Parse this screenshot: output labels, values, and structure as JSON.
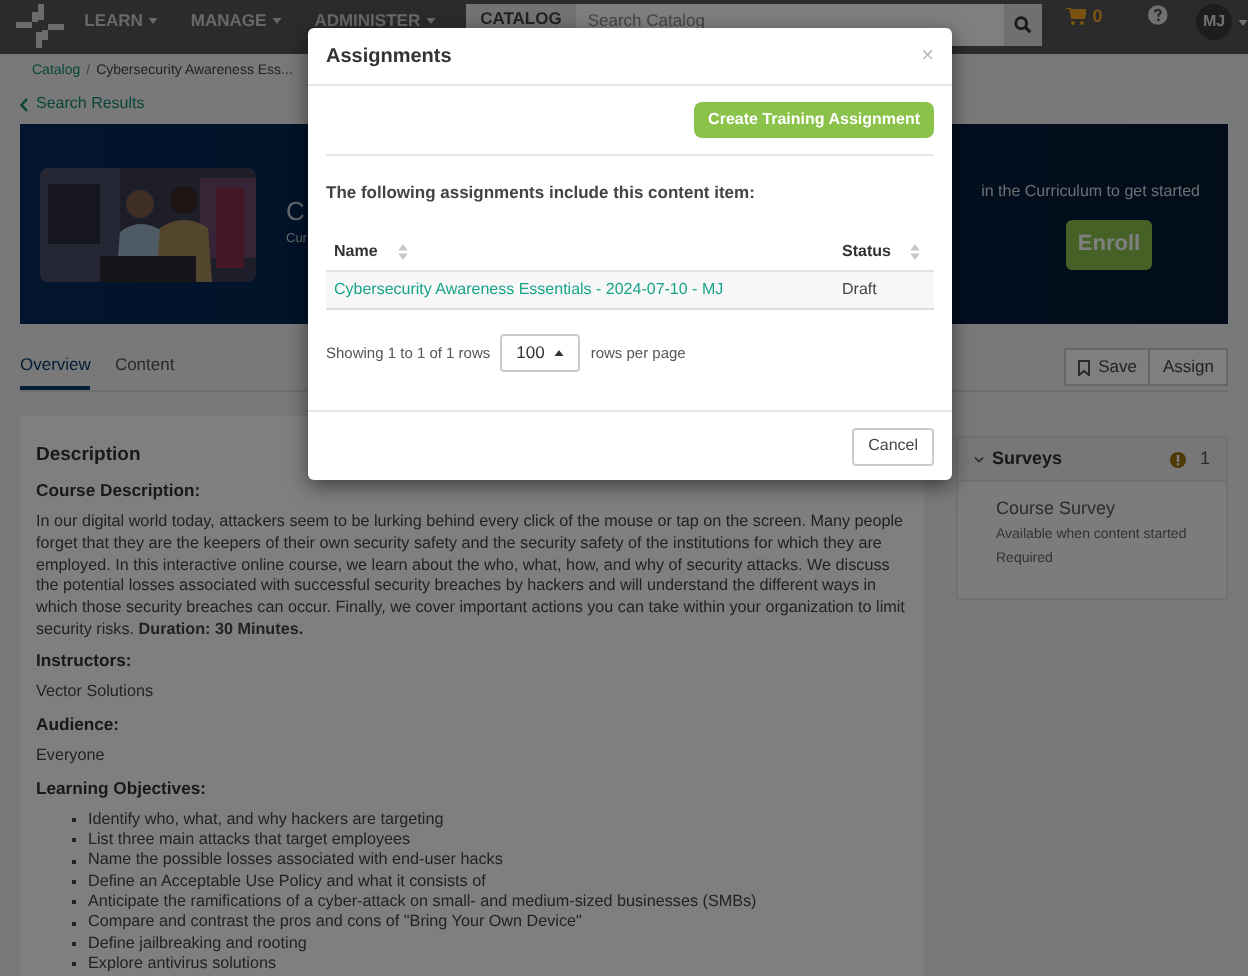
{
  "nav": {
    "items": [
      {
        "label": "LEARN"
      },
      {
        "label": "MANAGE"
      },
      {
        "label": "ADMINISTER"
      }
    ],
    "catalog_tab": "CATALOG",
    "search": {
      "placeholder": "Search Catalog"
    },
    "cart_count": "0",
    "user_initials": "MJ"
  },
  "breadcrumb": [
    "Catalog",
    "Cybersecurity Awareness Ess..."
  ],
  "breadcrumb_separator": "/",
  "back_link": "Search Results",
  "banner": {
    "title": "C",
    "subtitle": "Cur",
    "prompt": "in the Curriculum to get started",
    "enroll_button": "Enroll"
  },
  "tabs": [
    {
      "label": "Overview",
      "selected": true
    },
    {
      "label": "Content",
      "selected": false
    }
  ],
  "actions": [
    "Save",
    "Assign"
  ],
  "description": {
    "heading": "Description",
    "sections": [
      {
        "kind": "label",
        "text": "Course Description:"
      },
      {
        "kind": "paragraph",
        "text": "In our digital world today, attackers seem to be lurking behind every click of the mouse or tap on the screen. Many people forget that they are the keepers of their own security safety and the security safety of the institutions for which they are employed. In this interactive online course, we learn about the who, what, how, and why of security attacks. We discuss the potential losses associated with successful security breaches by hackers and will understand the different ways in which those security breaches can occur. Finally, we cover important actions you can take within your organization to limit security risks. **Duration: 30 Minutes.**"
      },
      {
        "kind": "label",
        "text": "Instructors:"
      },
      {
        "kind": "paragraph",
        "text": "Vector Solutions"
      },
      {
        "kind": "label",
        "text": "Audience:"
      },
      {
        "kind": "paragraph",
        "text": "Everyone"
      },
      {
        "kind": "label",
        "text": "Learning Objectives:"
      },
      {
        "kind": "list",
        "items": [
          "Identify who, what, and why hackers are targeting",
          "List three main attacks that target employees",
          "Name the possible losses associated with end-user hacks",
          "Define an Acceptable Use Policy and what it consists of",
          "Anticipate the ramifications of a cyber-attack on small- and medium-sized businesses (SMBs)",
          "Compare and contrast the pros and cons of \"Bring Your Own Device\"",
          "Define jailbreaking and rooting",
          "Explore antivirus solutions"
        ]
      }
    ]
  },
  "surveys": {
    "title": "Surveys",
    "count": "1",
    "expanded": true,
    "items": [
      {
        "name": "Course Survey",
        "availability": "Available when content started",
        "requirement": "Required"
      }
    ]
  },
  "modal": {
    "title": "Assignments",
    "close": "×",
    "create_button": "Create Training Assignment",
    "intro": "The following assignments include this content item:",
    "table": {
      "columns": [
        "Name",
        "Status"
      ],
      "rows": [
        {
          "name": "Cybersecurity Awareness Essentials - 2024-07-10 - MJ",
          "status": "Draft"
        }
      ]
    },
    "pagination": {
      "summary": "Showing 1 to 1 of 1 rows",
      "page_size": "100",
      "suffix": "rows per page"
    },
    "cancel_button": "Cancel"
  }
}
